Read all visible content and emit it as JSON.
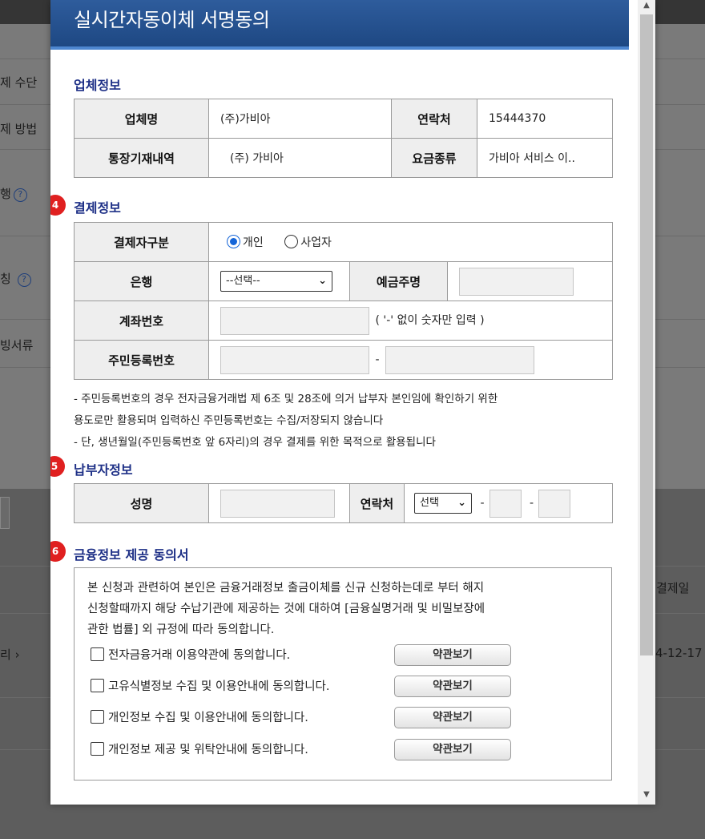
{
  "background": {
    "labels": [
      "제 수단",
      "제 방법",
      "행",
      "칭",
      "빙서류"
    ],
    "column_header": "결제일",
    "row_link": "리 ›",
    "row_date": "4-12-17"
  },
  "modal": {
    "title": "실시간자동이체 서명동의",
    "company_section": {
      "title": "업체정보",
      "name_label": "업체명",
      "name_value": "(주)가비아",
      "contact_label": "연락처",
      "contact_value": "15444370",
      "statement_label": "통장기재내역",
      "statement_value": "(주) 가비아",
      "fee_label": "요금종류",
      "fee_value": "가비아 서비스 이.."
    },
    "payment_section": {
      "number": "4",
      "title": "결제정보",
      "payer_type_label": "결제자구분",
      "payer_type_options": [
        "개인",
        "사업자"
      ],
      "payer_type_selected": "개인",
      "bank_label": "은행",
      "bank_select_value": "--선택--",
      "holder_label": "예금주명",
      "holder_value": "",
      "account_label": "계좌번호",
      "account_value": "",
      "account_hint": "( '-' 없이 숫자만 입력 )",
      "rrn_label": "주민등록번호",
      "rrn_separator": "-",
      "notes": [
        " - 주민등록번호의 경우 전자금융거래법 제 6조 및 28조에 의거 납부자 본인임에 확인하기 위한",
        "용도로만 활용되며 입력하신 주민등록번호는 수집/저장되지 않습니다",
        " - 단, 생년월일(주민등록번호 앞 6자리)의 경우 결제를 위한 목적으로 활용됩니다"
      ]
    },
    "payer_section": {
      "number": "5",
      "title": "납부자정보",
      "name_label": "성명",
      "name_value": "",
      "contact_label": "연락처",
      "contact_select_value": "선택",
      "separator": "-"
    },
    "consent_section": {
      "number": "6",
      "title": "금융정보 제공 동의서",
      "body_lines": [
        "본 신청과 관련하여 본인은 금융거래정보 출금이체를 신규 신청하는데로 부터 해지",
        "신청할때까지 해당 수납기관에 제공하는 것에 대하여 [금융실명거래 및 비밀보장에",
        "관한 법률] 외 규정에 따라 동의합니다."
      ],
      "agreements": [
        {
          "label": "전자금융거래 이용약관에 동의합니다.",
          "button": "약관보기",
          "checked": false
        },
        {
          "label": "고유식별정보 수집 및 이용안내에 동의합니다.",
          "button": "약관보기",
          "checked": false
        },
        {
          "label": "개인정보 수집 및 이용안내에 동의합니다.",
          "button": "약관보기",
          "checked": false
        },
        {
          "label": "개인정보 제공 및 위탁안내에 동의합니다.",
          "button": "약관보기",
          "checked": false
        }
      ]
    }
  },
  "colors": {
    "header": "#1e4883",
    "section_title": "#1d2f86",
    "step_badge": "#e02020",
    "radio_accent": "#1565d8"
  },
  "icons": [
    "help-icon",
    "chevron-down-icon",
    "scroll-up-arrow-icon",
    "scroll-down-arrow-icon",
    "radio-icon",
    "checkbox-icon"
  ]
}
